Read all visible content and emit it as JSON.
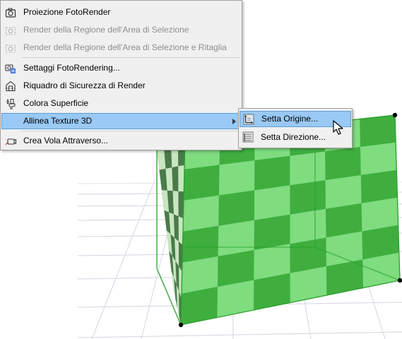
{
  "menu": {
    "items": [
      {
        "label": "Proiezione FotoRender",
        "icon": "camera-icon",
        "enabled": true
      },
      {
        "label": "Render della Regione dell'Area di Selezione",
        "icon": "camera-region-icon",
        "enabled": false
      },
      {
        "label": "Render della Regione dell'Area di Selezione e Ritaglia",
        "icon": "camera-crop-icon",
        "enabled": false
      },
      {
        "label": "Settaggi FotoRendering...",
        "icon": "render-settings-icon",
        "enabled": true
      },
      {
        "label": "Riquadro di Sicurezza di Render",
        "icon": "safe-frame-icon",
        "enabled": true
      },
      {
        "label": "Colora Superficie",
        "icon": "paint-brush-icon",
        "enabled": true
      },
      {
        "label": "Allinea Texture 3D",
        "icon": "",
        "enabled": true,
        "highlighted": true,
        "has_submenu": true
      },
      {
        "label": "Crea Vola Attraverso...",
        "icon": "fly-through-camera-icon",
        "enabled": true
      }
    ]
  },
  "submenu": {
    "items": [
      {
        "label": "Setta Origine...",
        "icon": "set-origin-icon",
        "highlighted": true
      },
      {
        "label": "Setta Direzione...",
        "icon": "set-direction-icon",
        "highlighted": false
      }
    ]
  },
  "colors": {
    "menu_bg": "#f0f0f0",
    "highlight": "#99c9f4",
    "texture_light": "#7fdc7f",
    "texture_dark": "#3fae3f"
  }
}
